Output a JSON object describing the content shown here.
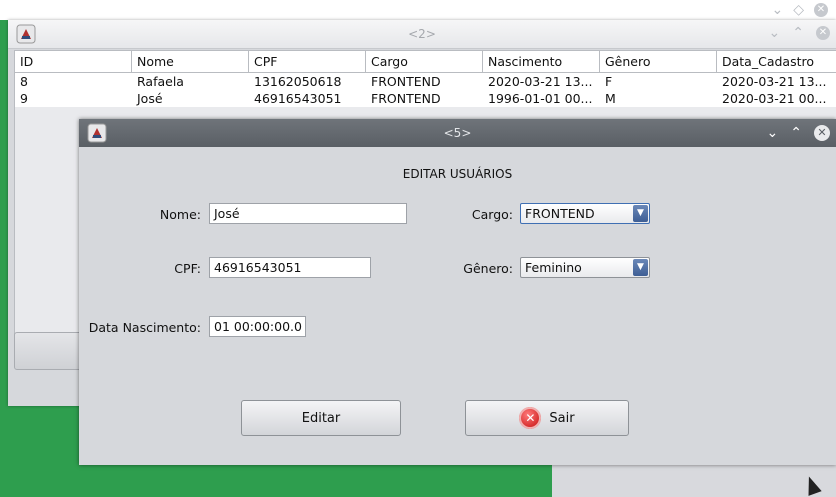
{
  "background_window": {
    "title": "<2>",
    "table": {
      "headers": [
        "ID",
        "Nome",
        "CPF",
        "Cargo",
        "Nascimento",
        "Gênero",
        "Data_Cadastro"
      ],
      "rows": [
        [
          "8",
          "Rafaela",
          "13162050618",
          "FRONTEND",
          "2020-03-21 13...",
          "F",
          "2020-03-21 13..."
        ],
        [
          "9",
          "José",
          "46916543051",
          "FRONTEND",
          "1996-01-01 00...",
          "M",
          "2020-03-21 00..."
        ]
      ]
    }
  },
  "dialog": {
    "title": "<5>",
    "heading": "EDITAR USUÁRIOS",
    "labels": {
      "nome": "Nome:",
      "cpf": "CPF:",
      "data_nascimento": "Data Nascimento:",
      "cargo": "Cargo:",
      "genero": "Gênero:"
    },
    "values": {
      "nome": "José",
      "cpf": "46916543051",
      "data_nascimento": "01 00:00:00.0",
      "cargo": "FRONTEND",
      "genero": "Feminino"
    },
    "buttons": {
      "editar": "Editar",
      "sair": "Sair"
    }
  },
  "colors": {
    "desktop_green": "#2e9e4e",
    "dialog_titlebar": "#5f646a"
  }
}
